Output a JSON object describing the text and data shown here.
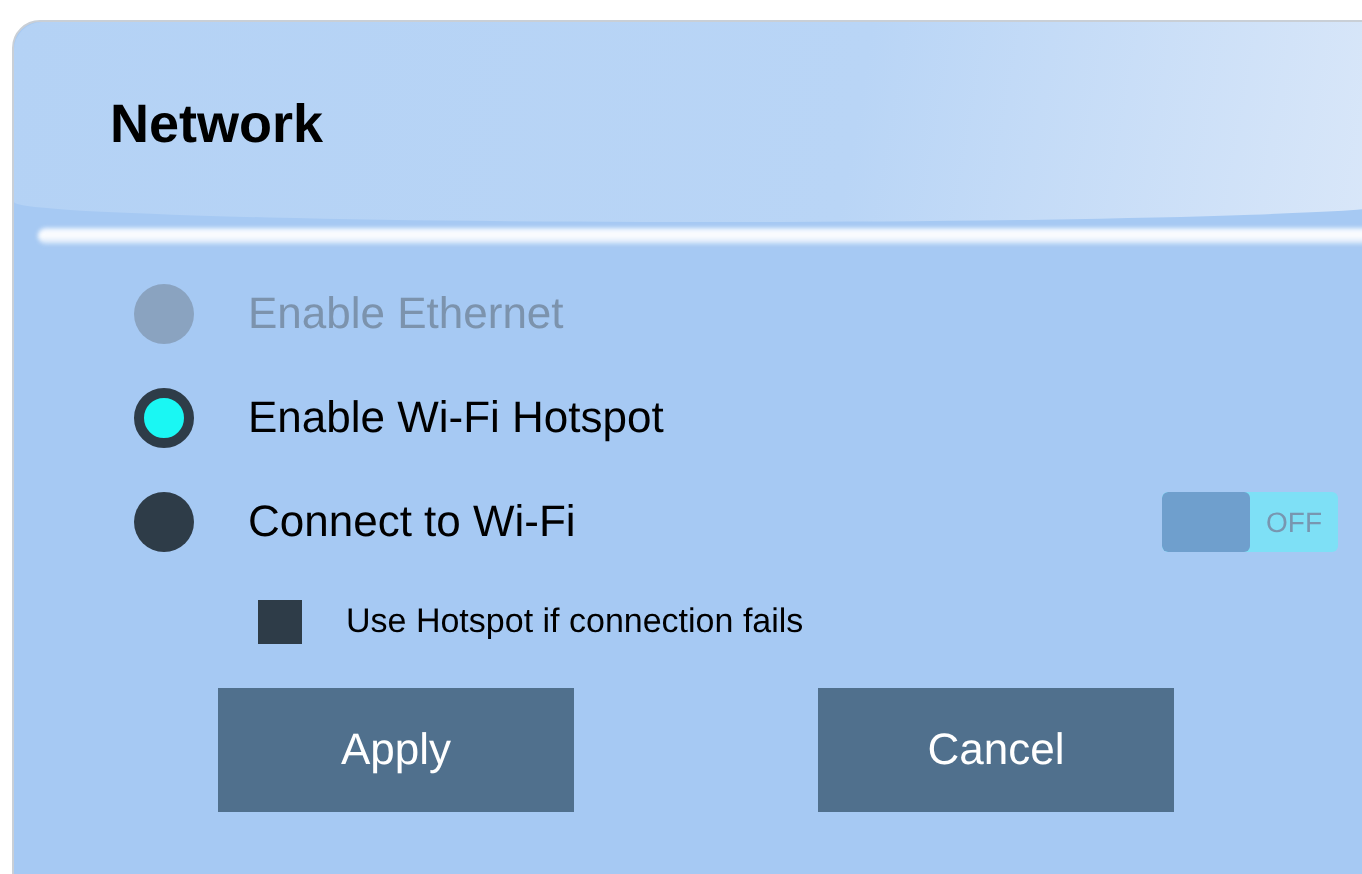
{
  "dialog": {
    "title": "Network"
  },
  "options": [
    {
      "label": "Enable Ethernet",
      "selected": false,
      "disabled": true
    },
    {
      "label": "Enable Wi-Fi Hotspot",
      "selected": true,
      "disabled": false
    },
    {
      "label": "Connect to Wi-Fi",
      "selected": false,
      "disabled": false
    }
  ],
  "wifi_toggle": {
    "label": "OFF",
    "on": false
  },
  "fallback": {
    "label": "Use Hotspot if connection fails",
    "checked": false
  },
  "buttons": [
    "Apply",
    "Cancel"
  ]
}
